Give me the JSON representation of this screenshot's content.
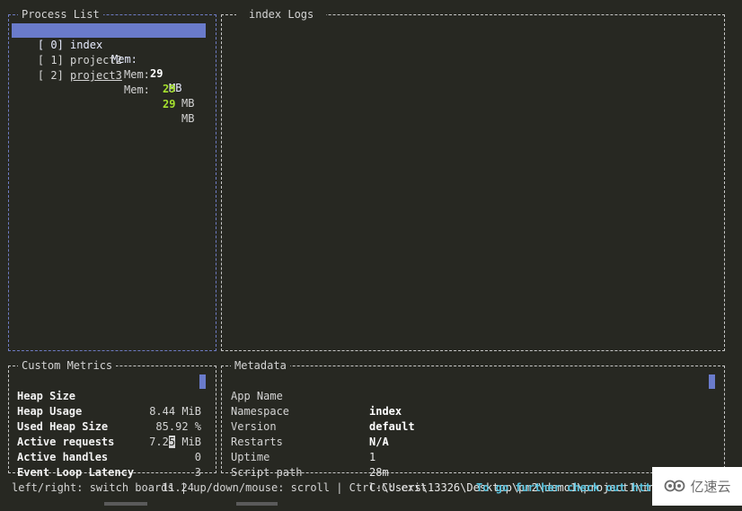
{
  "process_list": {
    "title": "Process List",
    "items": [
      {
        "id": "[ 0]",
        "name": "index",
        "mem_label": "Mem:",
        "mem_value": "29",
        "mem_unit": "MB",
        "selected": true
      },
      {
        "id": "[ 1]",
        "name": "project2",
        "mem_label": "Mem:",
        "mem_value": "29",
        "mem_unit": "MB",
        "selected": false
      },
      {
        "id": "[ 2]",
        "name": "project3",
        "mem_label": "Mem:",
        "mem_value": "29",
        "mem_unit": "MB",
        "selected": false
      }
    ]
  },
  "logs": {
    "title": "index Logs"
  },
  "custom_metrics": {
    "title": "Custom Metrics",
    "rows": [
      {
        "label": "Heap Size",
        "value": "8.44 MiB"
      },
      {
        "label": "Heap Usage",
        "value": "85.92 %"
      },
      {
        "label": "Used Heap Size",
        "value_pre": "7.2",
        "value_cursor": "5",
        "value_post": " MiB"
      },
      {
        "label": "Active requests",
        "value": "0"
      },
      {
        "label": "Active handles",
        "value": "3"
      },
      {
        "label": "Event Loop Latency",
        "value": "11.24"
      }
    ]
  },
  "metadata": {
    "title": "Metadata",
    "rows": [
      {
        "key": "App Name",
        "value": "index"
      },
      {
        "key": "Namespace",
        "value": "default"
      },
      {
        "key": "Version",
        "value": "N/A"
      },
      {
        "key": "Restarts",
        "value": "1"
      },
      {
        "key": "Uptime",
        "value": "28m"
      },
      {
        "key": "Script path",
        "value": "C:\\Users\\13326\\Desktop\\pm2\\demo1\\project1\\index.js"
      }
    ]
  },
  "footer": {
    "help": "left/right: switch boards | up/down/mouse: scroll | Ctrl-C: exit",
    "link": "To go further check out http"
  },
  "watermark": {
    "text": "亿速云",
    "icon": "cloud-logo-icon"
  },
  "colors": {
    "accent": "#6a7bcb",
    "mem_value": "#a6e22e",
    "link": "#5bc3de",
    "background": "#272822"
  }
}
